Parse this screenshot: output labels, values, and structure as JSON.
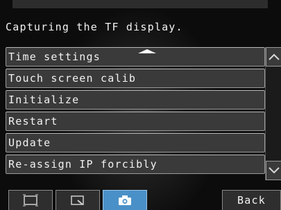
{
  "status": {
    "message": "Capturing the TF display."
  },
  "menu": {
    "items": [
      {
        "label": "Time settings"
      },
      {
        "label": "Touch screen calib"
      },
      {
        "label": "Initialize"
      },
      {
        "label": "Restart"
      },
      {
        "label": "Update"
      },
      {
        "label": "Re-assign IP forcibly"
      }
    ]
  },
  "toolbar": {
    "buttons": [
      {
        "icon": "fullscreen-icon"
      },
      {
        "icon": "zoom-window-icon"
      },
      {
        "icon": "camera-icon",
        "active": true
      }
    ],
    "back_label": "Back"
  },
  "colors": {
    "active": "#4a90c8",
    "item_bg": "#3a3a3a"
  }
}
